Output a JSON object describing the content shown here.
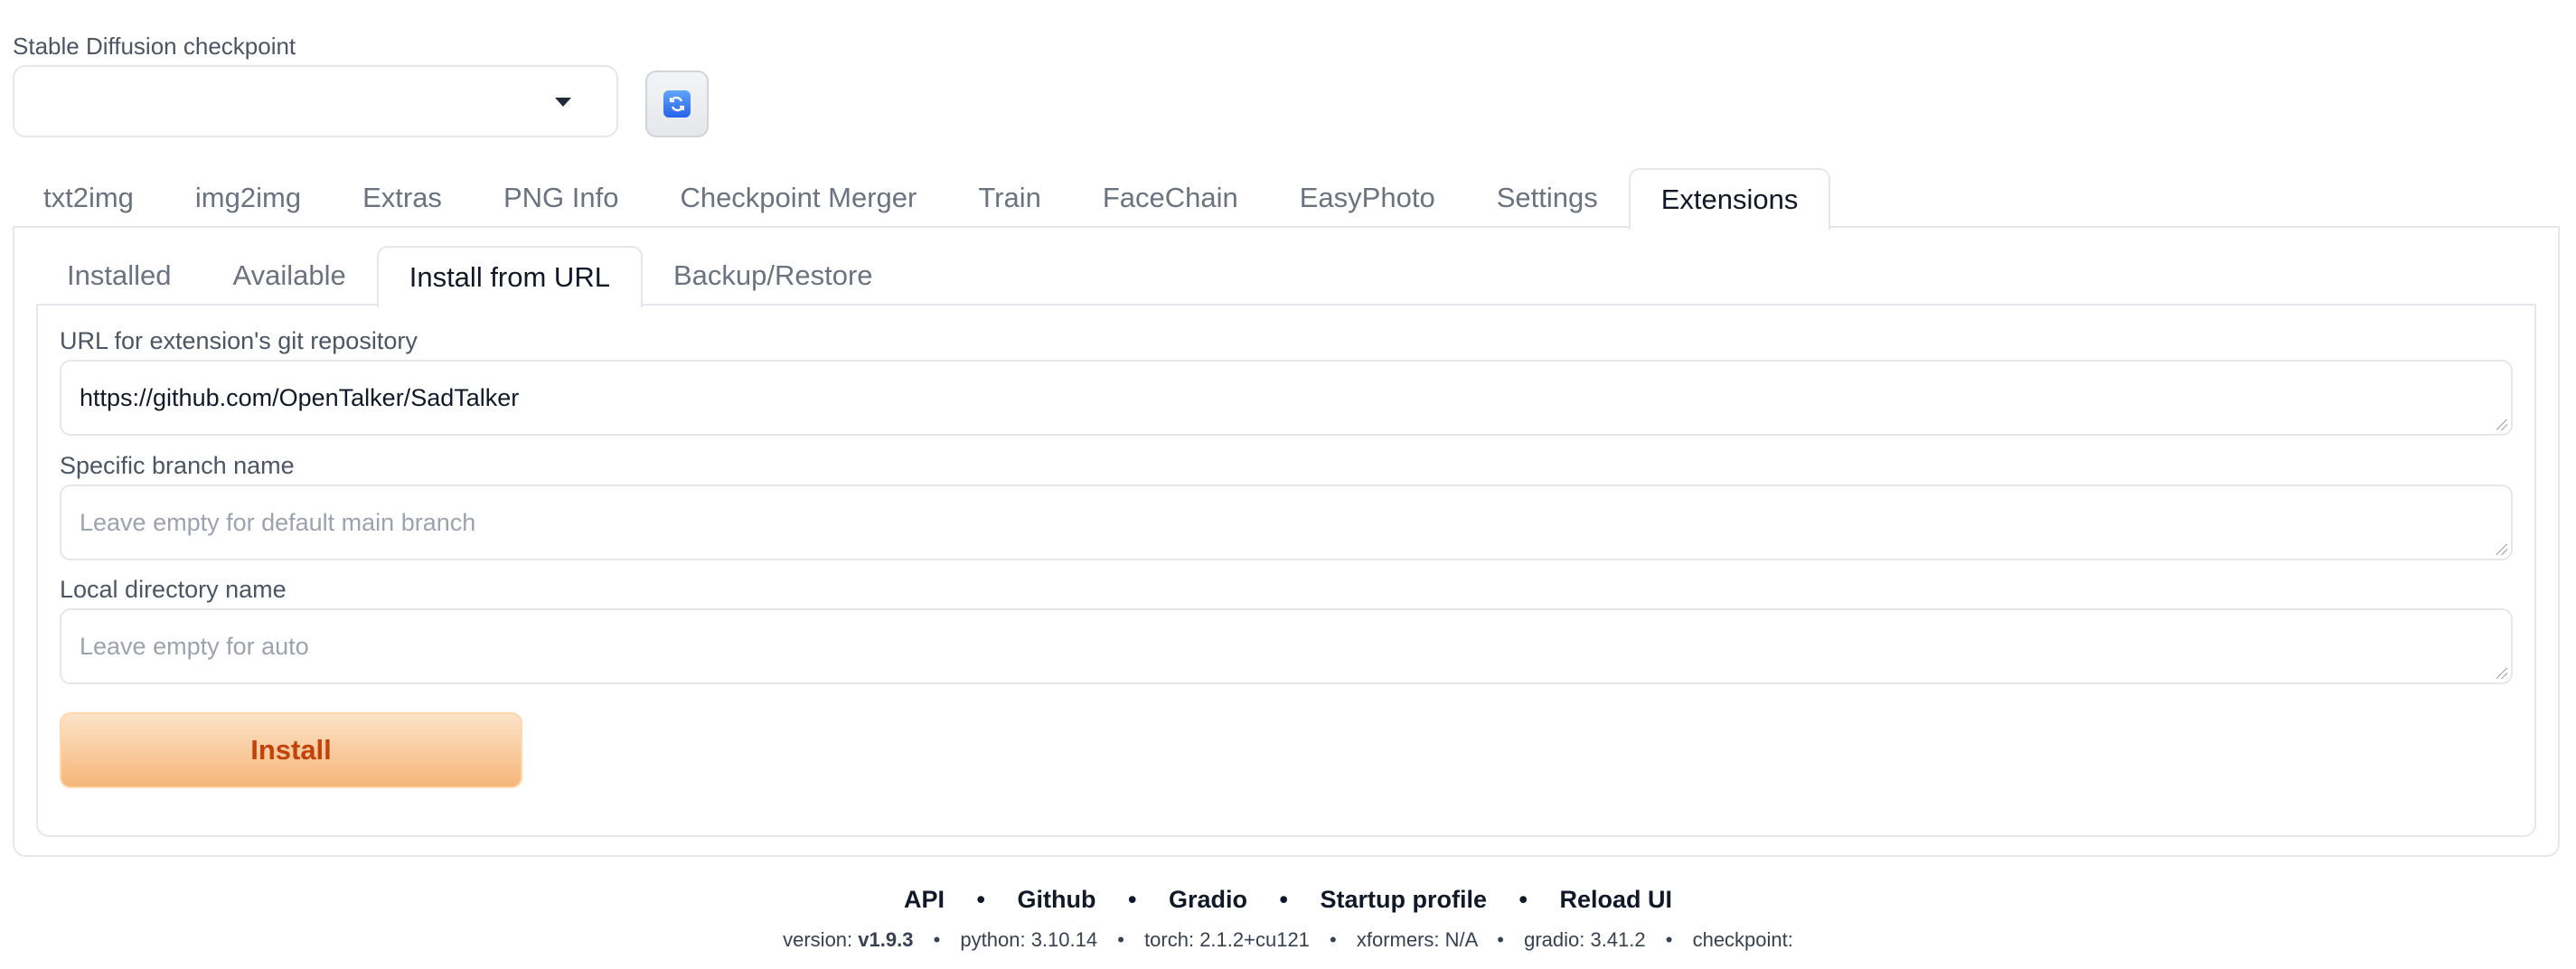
{
  "checkpoint": {
    "label": "Stable Diffusion checkpoint",
    "value": ""
  },
  "main_tabs": [
    "txt2img",
    "img2img",
    "Extras",
    "PNG Info",
    "Checkpoint Merger",
    "Train",
    "FaceChain",
    "EasyPhoto",
    "Settings",
    "Extensions"
  ],
  "sub_tabs": [
    "Installed",
    "Available",
    "Install from URL",
    "Backup/Restore"
  ],
  "form": {
    "url_label": "URL for extension's git repository",
    "url_value": "https://github.com/OpenTalker/SadTalker",
    "branch_label": "Specific branch name",
    "branch_placeholder": "Leave empty for default main branch",
    "dir_label": "Local directory name",
    "dir_placeholder": "Leave empty for auto",
    "install_label": "Install"
  },
  "footer": {
    "links": [
      "API",
      "Github",
      "Gradio",
      "Startup profile",
      "Reload UI"
    ],
    "version_label": "version:",
    "version": "v1.9.3",
    "python": "python: 3.10.14",
    "torch": "torch: 2.1.2+cu121",
    "xformers": "xformers: N/A",
    "gradio": "gradio: 3.41.2",
    "checkpoint": "checkpoint:"
  },
  "colors": {
    "accent": "#f5b679",
    "install_text": "#c2410c"
  }
}
